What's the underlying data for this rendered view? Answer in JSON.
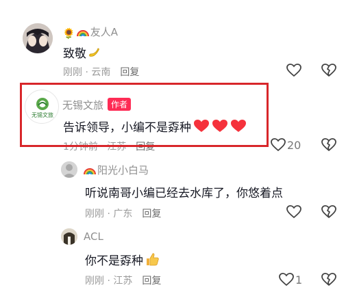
{
  "comments": [
    {
      "name": "友人A",
      "prefix_icons": [
        "sunflower-emoji",
        "rainbow-emoji"
      ],
      "text": "致敬",
      "text_emoji": "banana-emoji",
      "time": "刚刚",
      "location": "云南",
      "reply_label": "回复",
      "likes": ""
    },
    {
      "name": "无锡文旅",
      "badge": "作者",
      "text": "告诉领导，小编不是孬种",
      "text_emoji": "three-red-hearts-emoji",
      "time": "1分钟前",
      "location": "江苏",
      "reply_label": "回复",
      "likes": "20"
    },
    {
      "name": "阳光小白马",
      "prefix_icons": [
        "rainbow-emoji"
      ],
      "text": "听说南哥小编已经去水库了，你悠着点",
      "time": "刚刚",
      "location": "广东",
      "reply_label": "回复",
      "likes": ""
    },
    {
      "name": "ACL",
      "text": "你不是孬种",
      "text_emoji": "thumbs-up-emoji",
      "time": "刚刚",
      "location": "江苏",
      "reply_label": "回复",
      "likes": "1"
    }
  ],
  "meta_separator": " · ",
  "logo_text": "无锡文旅",
  "colors": {
    "highlight_border": "#d8262a",
    "author_badge": "#fe2c55",
    "heart_red": "#f5323c"
  }
}
